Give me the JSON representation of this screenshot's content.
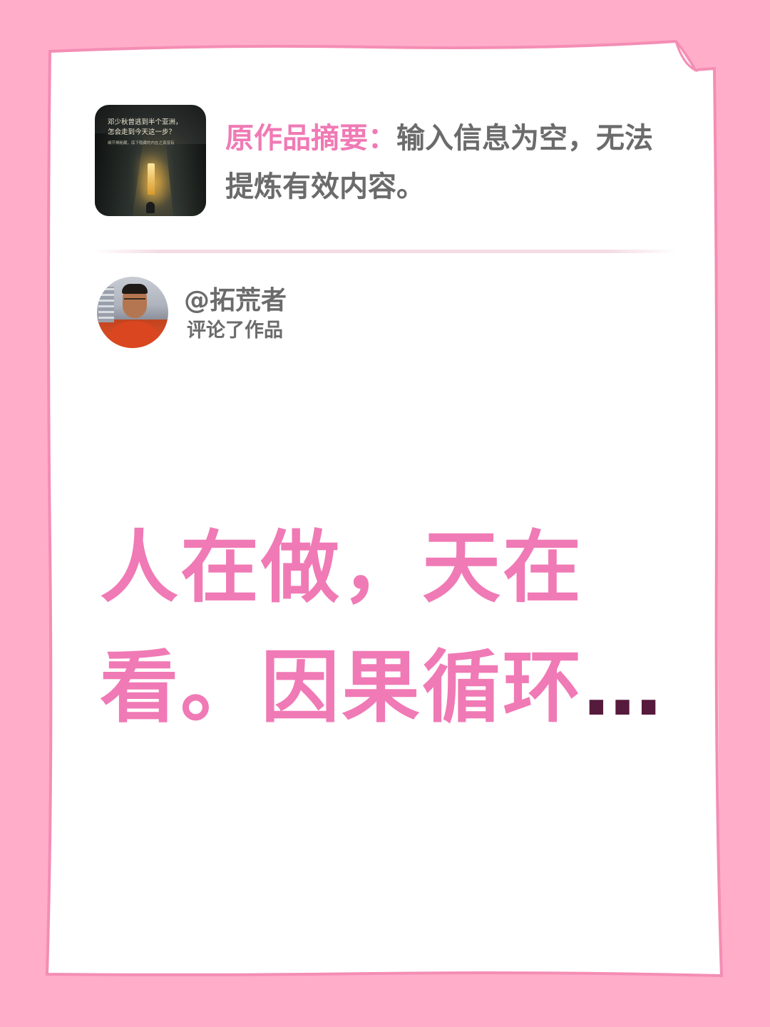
{
  "work": {
    "cover_text_line1": "邓少秋曾逃到半个亚洲，",
    "cover_text_line2": "怎会走到今天这一步？",
    "cover_text_line3": "细节揭秘藏，底下隐藏的内在之真没有",
    "summary_label": "原作品摘要：",
    "summary_text": "输入信息为空，无法提炼有效内容。"
  },
  "comment": {
    "handle": "@拓荒者",
    "action": "评论了作品",
    "text_main": "人在做，天在看。因果循环",
    "text_ellipsis": "…"
  },
  "colors": {
    "background": "#ffadc8",
    "paper": "#ffffff",
    "accent_pink": "#f07ab5",
    "ellipsis": "#561a3c",
    "gray_text": "#6b6b6b"
  }
}
